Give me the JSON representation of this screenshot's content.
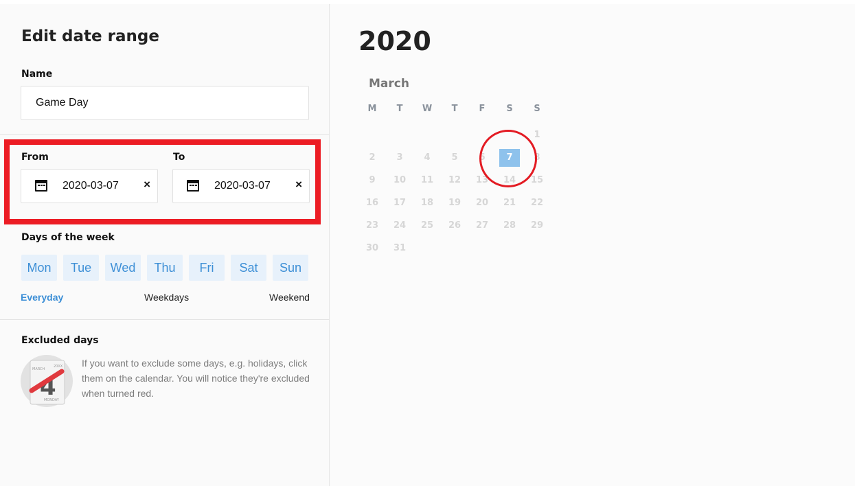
{
  "panel": {
    "title": "Edit date range",
    "name_label": "Name",
    "name_value": "Game Day",
    "from_label": "From",
    "from_value": "2020-03-07",
    "to_label": "To",
    "to_value": "2020-03-07",
    "clear_icon": "×",
    "days_label": "Days of the week",
    "days": [
      "Mon",
      "Tue",
      "Wed",
      "Thu",
      "Fri",
      "Sat",
      "Sun"
    ],
    "presets": [
      "Everyday",
      "Weekdays",
      "Weekend"
    ],
    "active_preset": "Everyday",
    "excluded_label": "Excluded days",
    "excluded_help": "If you want to exclude some days, e.g. holidays, click them on the calendar. You will notice they're excluded when turned red.",
    "illustration": {
      "month": "MARCH",
      "year": "20XX",
      "day": "4",
      "weekday": "MONDAY"
    }
  },
  "calendar": {
    "year": "2020",
    "month": "March",
    "weekdays": [
      "M",
      "T",
      "W",
      "T",
      "F",
      "S",
      "S"
    ],
    "first_weekday_index": 6,
    "days_in_month": 31,
    "selected_day": 7
  },
  "colors": {
    "accent": "#3d8fd6",
    "selected": "#8ec2ec",
    "annotation": "#ec1c24"
  }
}
